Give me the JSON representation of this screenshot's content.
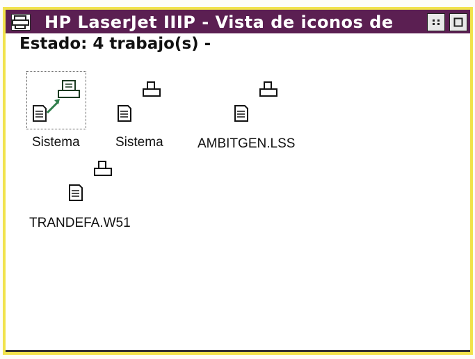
{
  "window": {
    "title": "HP LaserJet IIIP - Vista de iconos de",
    "sys_menu_icon": "printer-window-icon",
    "minimize_icon": "minimize-icon",
    "maximize_icon": "maximize-icon"
  },
  "status": {
    "label": "Estado:",
    "value": "4 trabajo(s)",
    "suffix": "-"
  },
  "jobs": [
    {
      "label": "Sistema",
      "icon": "printing-job-icon",
      "selected": true
    },
    {
      "label": "Sistema",
      "icon": "print-job-icon",
      "selected": false
    },
    {
      "label": "AMBITGEN.LSS",
      "icon": "print-job-icon",
      "selected": false
    },
    {
      "label": "TRANDEFA.W51",
      "icon": "print-job-icon",
      "selected": false
    }
  ],
  "colors": {
    "titlebar": "#5b1f52",
    "frame": "#f1e34c",
    "active_arrow": "#2e7d4a"
  }
}
